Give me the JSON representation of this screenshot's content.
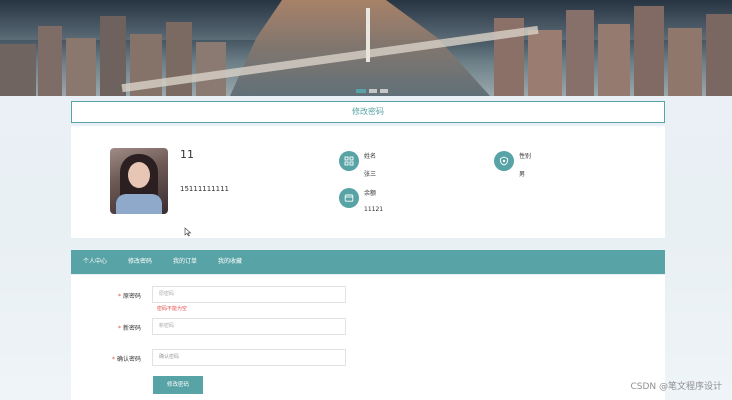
{
  "banner": {
    "carousel_dots": 3,
    "active_dot": 1
  },
  "header": {
    "title": "修改密码"
  },
  "profile": {
    "name": "11",
    "phone": "15111111111",
    "fields": [
      {
        "label": "姓名",
        "value": "张三",
        "icon": "grid-icon"
      },
      {
        "label": "性别",
        "value": "男",
        "icon": "shield-icon"
      },
      {
        "label": "余额",
        "value": "11121",
        "icon": "wallet-icon"
      }
    ]
  },
  "nav": {
    "items": [
      "个人中心",
      "修改密码",
      "我的订单",
      "我的收藏"
    ]
  },
  "form": {
    "fields": [
      {
        "label": "原密码",
        "placeholder": "原密码",
        "error": "密码不能为空"
      },
      {
        "label": "新密码",
        "placeholder": "新密码"
      },
      {
        "label": "确认密码",
        "placeholder": "确认密码"
      }
    ],
    "submit_label": "修改密码"
  },
  "watermark": "CSDN @笔文程序设计",
  "colors": {
    "accent": "#58a3a6",
    "error": "#e24c4c"
  }
}
